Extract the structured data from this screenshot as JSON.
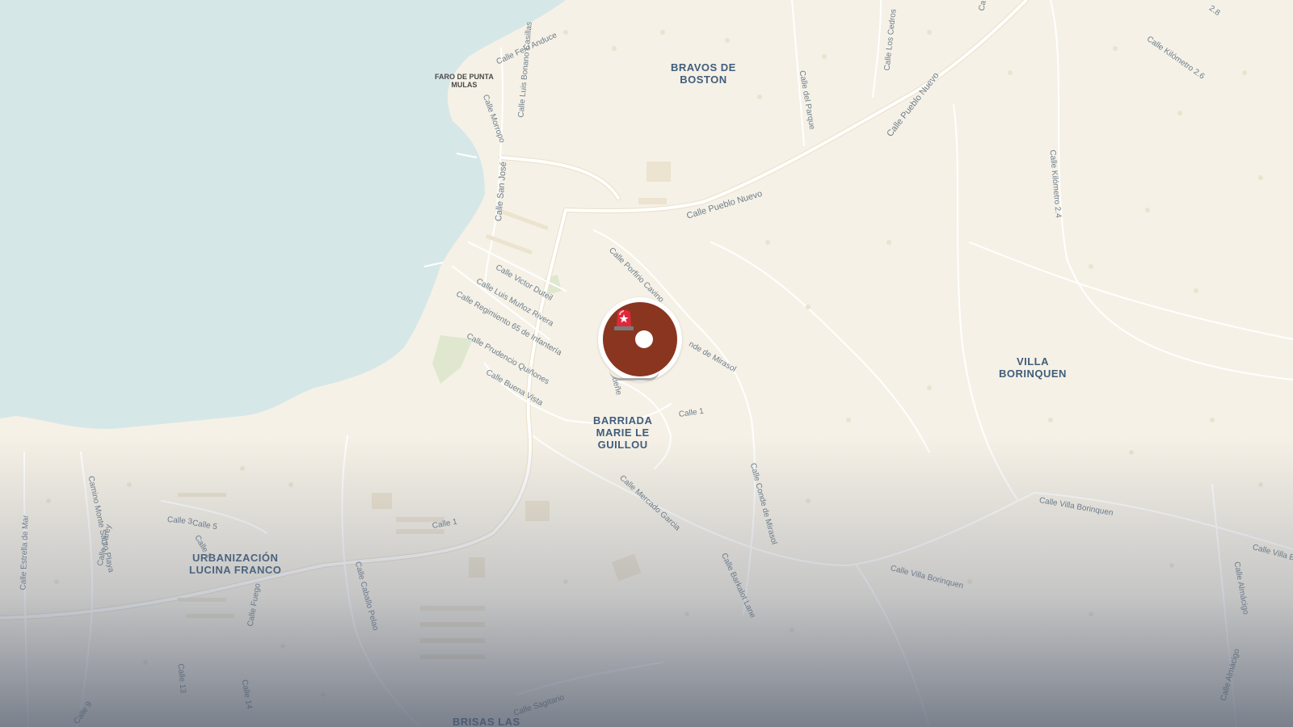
{
  "map": {
    "colors": {
      "land": "#f6f1e6",
      "water": "#d6e7e8",
      "road": "#ffffff",
      "road_edge": "#e8dcc4",
      "park": "#dfe8cf",
      "marker": "#8a3520",
      "place_label": "#3f5d7c",
      "street_label": "#6b7d8c"
    },
    "places": [
      {
        "id": "bravos",
        "lines": [
          "BRAVOS DE",
          "BOSTON"
        ]
      },
      {
        "id": "villa",
        "lines": [
          "VILLA",
          "BORINQUEN"
        ]
      },
      {
        "id": "barriada",
        "lines": [
          "BARRIADA",
          "MARIE LE",
          "GUILLOU"
        ]
      },
      {
        "id": "urbanizacion",
        "lines": [
          "URBANIZACIÓN",
          "LUCINA FRANCO"
        ]
      },
      {
        "id": "brisas",
        "lines": [
          "BRISAS LAS"
        ]
      }
    ],
    "poi": {
      "lines": [
        "FARO DE PUNTA",
        "MULAS"
      ]
    },
    "streets": [
      "Calle Felo Anduce",
      "Calle Luis Bonano Casillas",
      "Calle Morropo",
      "Calle San José",
      "Calle Pueblo Nuevo",
      "Calle Pueblo Nuevo",
      "Calle Porfirio Cavino",
      "nde de Mirasol",
      "Calle Victor Duteil",
      "Calle Luis Muñoz Rivera",
      "Calle Regimiento 65 de Infantería",
      "Calle Prudencio Quiñones",
      "Calle Buena Vista",
      "Calle 1",
      "ueñe",
      "Calle Mercado Garcia",
      "Calle Conde de Mirasol",
      "Calle Barkalot Lane",
      "Calle del Parque",
      "Calle Los Cedros",
      "Calle Kilómetro 2.6",
      "Calle Kilómetro 2.4",
      "Calle Villa Borinquen",
      "Calle Villa Borinquen",
      "Calle Villa B",
      "Calle Almácigo",
      "Calle Almácigo",
      "Calle 3",
      "Calle 5",
      "Calle 2",
      "Camino Monte Santo Playa",
      "Calle Carey",
      "Calle Estrella de Mar",
      "Calle Fuego",
      "Calle Caballo Pelao",
      "Calle 1",
      "Calle 13",
      "Calle 14",
      "Calle 9",
      "Calle Sagitario",
      "2.8",
      "Ca"
    ],
    "marker": {
      "icon": "siren-icon"
    }
  }
}
